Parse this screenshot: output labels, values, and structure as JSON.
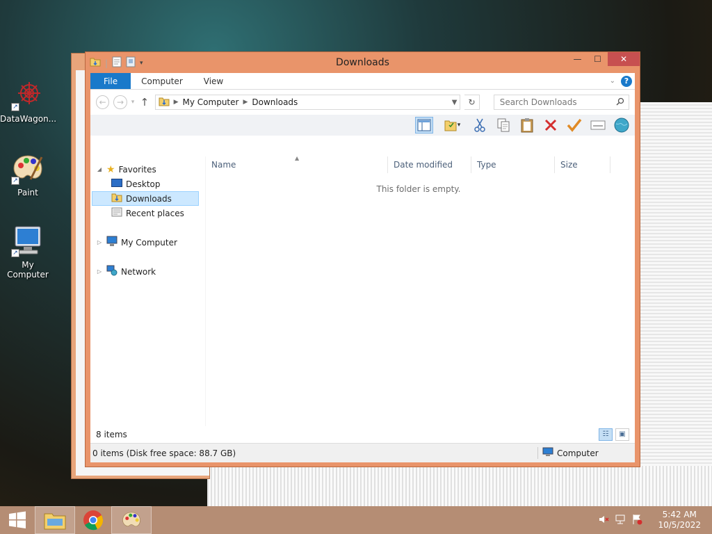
{
  "desktop": {
    "icons": [
      {
        "label": "DataWagon..."
      },
      {
        "label": "Paint"
      },
      {
        "label": "My Computer"
      }
    ]
  },
  "window": {
    "title": "Downloads",
    "caption": {
      "minimize": "—",
      "maximize": "☐",
      "close": "✕"
    },
    "ribbon_tabs": [
      "File",
      "Computer",
      "View"
    ],
    "address": {
      "root": "My Computer",
      "current": "Downloads"
    },
    "search_placeholder": "Search Downloads",
    "navpane": {
      "favorites": "Favorites",
      "desktop": "Desktop",
      "downloads": "Downloads",
      "recent": "Recent places",
      "my_computer": "My Computer",
      "network": "Network"
    },
    "columns": [
      "Name",
      "Date modified",
      "Type",
      "Size"
    ],
    "empty_message": "This folder is empty.",
    "items_count": "8 items",
    "status_text": "0 items (Disk free space: 88.7 GB)",
    "status_zone": "Computer"
  },
  "taskbar": {
    "time": "5:42 AM",
    "date": "10/5/2022"
  },
  "colors": {
    "window_frame": "#e9946a",
    "file_tab": "#1979ca",
    "close_button": "#c75050",
    "taskbar": "#b58d74"
  }
}
